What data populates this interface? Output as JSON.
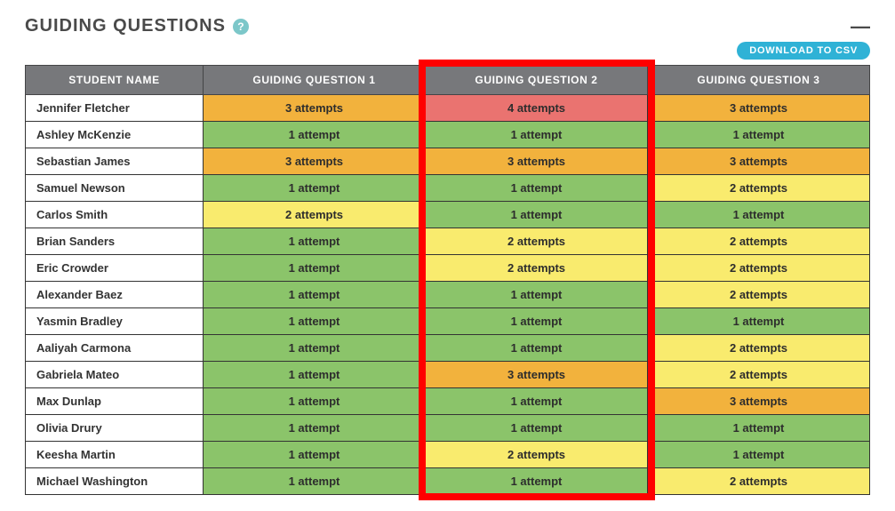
{
  "header": {
    "title": "GUIDING QUESTIONS",
    "help_tooltip": "?",
    "collapse_symbol": "—",
    "download_label": "DOWNLOAD TO CSV"
  },
  "columns": [
    "STUDENT NAME",
    "GUIDING QUESTION 1",
    "GUIDING QUESTION 2",
    "GUIDING QUESTION 3"
  ],
  "color_map": {
    "green": "#8bc46a",
    "yellow": "#f9eb6e",
    "orange": "#f2b23d",
    "red": "#ea7370"
  },
  "rows": [
    {
      "name": "Jennifer Fletcher",
      "cells": [
        {
          "text": "3 attempts",
          "color": "orange"
        },
        {
          "text": "4 attempts",
          "color": "red"
        },
        {
          "text": "3 attempts",
          "color": "orange"
        }
      ]
    },
    {
      "name": "Ashley McKenzie",
      "cells": [
        {
          "text": "1 attempt",
          "color": "green"
        },
        {
          "text": "1 attempt",
          "color": "green"
        },
        {
          "text": "1 attempt",
          "color": "green"
        }
      ]
    },
    {
      "name": "Sebastian James",
      "cells": [
        {
          "text": "3 attempts",
          "color": "orange"
        },
        {
          "text": "3 attempts",
          "color": "orange"
        },
        {
          "text": "3 attempts",
          "color": "orange"
        }
      ]
    },
    {
      "name": "Samuel Newson",
      "cells": [
        {
          "text": "1 attempt",
          "color": "green"
        },
        {
          "text": "1 attempt",
          "color": "green"
        },
        {
          "text": "2 attempts",
          "color": "yellow"
        }
      ]
    },
    {
      "name": "Carlos Smith",
      "cells": [
        {
          "text": "2 attempts",
          "color": "yellow"
        },
        {
          "text": "1 attempt",
          "color": "green"
        },
        {
          "text": "1 attempt",
          "color": "green"
        }
      ]
    },
    {
      "name": "Brian Sanders",
      "cells": [
        {
          "text": "1 attempt",
          "color": "green"
        },
        {
          "text": "2 attempts",
          "color": "yellow"
        },
        {
          "text": "2 attempts",
          "color": "yellow"
        }
      ]
    },
    {
      "name": "Eric Crowder",
      "cells": [
        {
          "text": "1 attempt",
          "color": "green"
        },
        {
          "text": "2 attempts",
          "color": "yellow"
        },
        {
          "text": "2 attempts",
          "color": "yellow"
        }
      ]
    },
    {
      "name": "Alexander Baez",
      "cells": [
        {
          "text": "1 attempt",
          "color": "green"
        },
        {
          "text": "1 attempt",
          "color": "green"
        },
        {
          "text": "2 attempts",
          "color": "yellow"
        }
      ]
    },
    {
      "name": "Yasmin Bradley",
      "cells": [
        {
          "text": "1 attempt",
          "color": "green"
        },
        {
          "text": "1 attempt",
          "color": "green"
        },
        {
          "text": "1 attempt",
          "color": "green"
        }
      ]
    },
    {
      "name": "Aaliyah Carmona",
      "cells": [
        {
          "text": "1 attempt",
          "color": "green"
        },
        {
          "text": "1 attempt",
          "color": "green"
        },
        {
          "text": "2 attempts",
          "color": "yellow"
        }
      ]
    },
    {
      "name": "Gabriela Mateo",
      "cells": [
        {
          "text": "1 attempt",
          "color": "green"
        },
        {
          "text": "3 attempts",
          "color": "orange"
        },
        {
          "text": "2 attempts",
          "color": "yellow"
        }
      ]
    },
    {
      "name": "Max Dunlap",
      "cells": [
        {
          "text": "1 attempt",
          "color": "green"
        },
        {
          "text": "1 attempt",
          "color": "green"
        },
        {
          "text": "3 attempts",
          "color": "orange"
        }
      ]
    },
    {
      "name": "Olivia Drury",
      "cells": [
        {
          "text": "1 attempt",
          "color": "green"
        },
        {
          "text": "1 attempt",
          "color": "green"
        },
        {
          "text": "1 attempt",
          "color": "green"
        }
      ]
    },
    {
      "name": "Keesha Martin",
      "cells": [
        {
          "text": "1 attempt",
          "color": "green"
        },
        {
          "text": "2 attempts",
          "color": "yellow"
        },
        {
          "text": "1 attempt",
          "color": "green"
        }
      ]
    },
    {
      "name": "Michael Washington",
      "cells": [
        {
          "text": "1 attempt",
          "color": "green"
        },
        {
          "text": "1 attempt",
          "color": "green"
        },
        {
          "text": "2 attempts",
          "color": "yellow"
        }
      ]
    }
  ],
  "highlight_column_index": 2
}
